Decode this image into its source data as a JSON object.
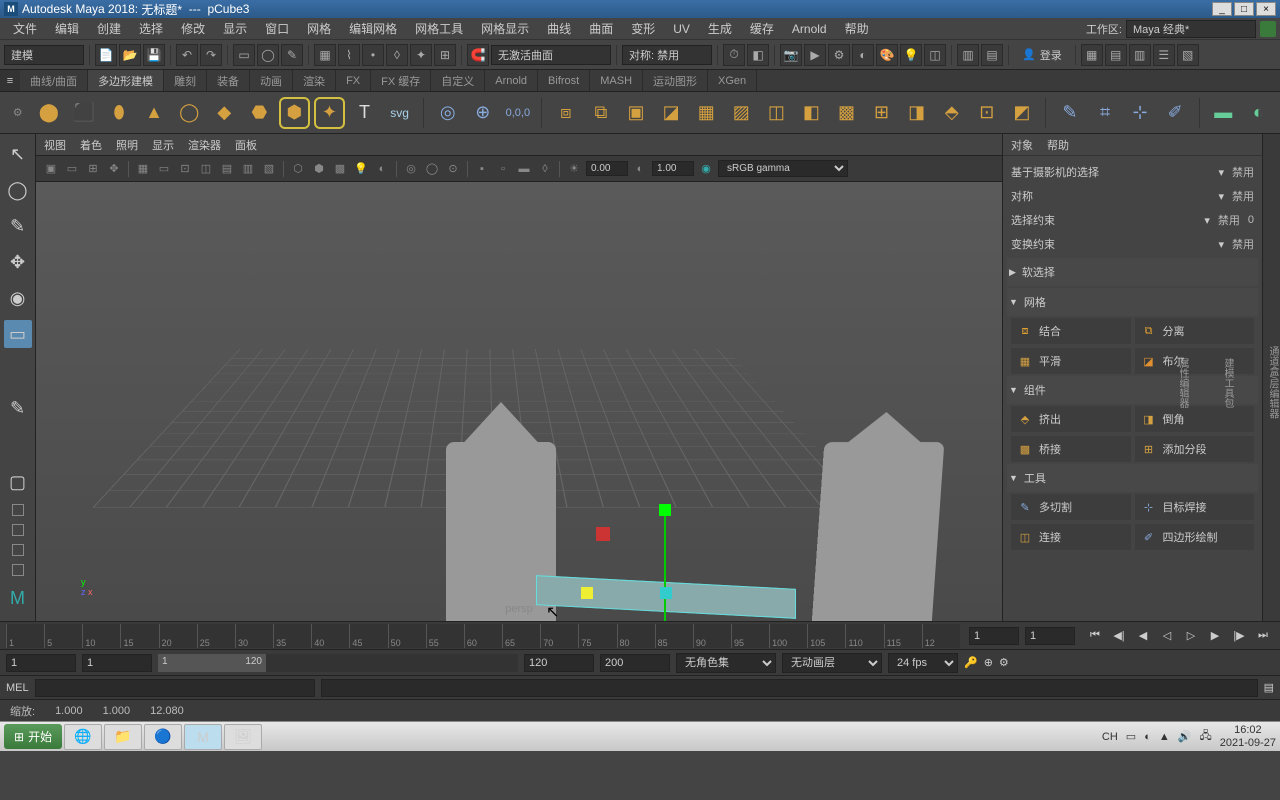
{
  "title": {
    "app": "Autodesk Maya 2018:",
    "doc": "无标题*",
    "sep": "---",
    "obj": "pCube3",
    "logo": "M"
  },
  "win": {
    "min": "_",
    "max": "□",
    "close": "×"
  },
  "menu": {
    "items": [
      "文件",
      "编辑",
      "创建",
      "选择",
      "修改",
      "显示",
      "窗口",
      "网格",
      "编辑网格",
      "网格工具",
      "网格显示",
      "曲线",
      "曲面",
      "变形",
      "UV",
      "生成",
      "缓存",
      "Arnold",
      "帮助"
    ],
    "workspace_label": "工作区:",
    "workspace_value": "Maya 经典*"
  },
  "toolbar": {
    "mode": "建模",
    "curve_mode": "无激活曲面",
    "sym": "对称: 禁用",
    "login": "登录"
  },
  "shelf": {
    "tabs": [
      "曲线/曲面",
      "多边形建模",
      "雕刻",
      "装备",
      "动画",
      "渲染",
      "FX",
      "FX 缓存",
      "自定义",
      "Arnold",
      "Bifrost",
      "MASH",
      "运动图形",
      "XGen"
    ],
    "active": 1,
    "svg": "svg",
    "text": "T"
  },
  "viewMenu": {
    "items": [
      "视图",
      "着色",
      "照明",
      "显示",
      "渲染器",
      "面板"
    ]
  },
  "viewToolbar": {
    "exposure": "0.00",
    "gamma": "1.00",
    "colorspace": "sRGB gamma"
  },
  "viewport": {
    "camera": "persp",
    "axes": {
      "x": "x",
      "y": "y",
      "z": "z"
    }
  },
  "rightPanel": {
    "tabs": [
      "对象",
      "帮助"
    ],
    "cam_sel_label": "基于摄影机的选择",
    "cam_sel_val": "禁用",
    "sym_label": "对称",
    "sym_val": "禁用",
    "selcon_label": "选择约束",
    "selcon_val": "禁用",
    "selcon_num": "0",
    "xformcon_label": "变换约束",
    "xformcon_val": "禁用",
    "softsel": "软选择",
    "sec_mesh": "网格",
    "btn_combine": "结合",
    "btn_separate": "分离",
    "btn_smooth": "平滑",
    "btn_bool": "布尔",
    "sec_comp": "组件",
    "btn_extrude": "挤出",
    "btn_bevel": "倒角",
    "btn_bridge": "桥接",
    "btn_subdiv": "添加分段",
    "sec_tools": "工具",
    "btn_multicut": "多切割",
    "btn_targetweld": "目标焊接",
    "btn_connect": "连接",
    "btn_quaddraw": "四边形绘制"
  },
  "sideTabs": [
    "通道盒/层编辑器",
    "建模工具包",
    "属性编辑器"
  ],
  "timeline": {
    "ticks": [
      "1",
      "5",
      "10",
      "15",
      "20",
      "25",
      "30",
      "35",
      "40",
      "45",
      "50",
      "55",
      "60",
      "65",
      "70",
      "75",
      "80",
      "85",
      "90",
      "95",
      "100",
      "105",
      "110",
      "115",
      "12"
    ],
    "current": "1",
    "current2": "1"
  },
  "range": {
    "start": "1",
    "in": "1",
    "inshow": "1",
    "out": "120",
    "outshow": "120",
    "end": "200",
    "charset": "无角色集",
    "animlayer": "无动画层",
    "fps": "24 fps"
  },
  "cmd": {
    "lang": "MEL"
  },
  "help": {
    "zoom": "缩放:",
    "v1": "1.000",
    "v2": "1.000",
    "v3": "12.080"
  },
  "taskbar": {
    "start": "开始",
    "lang": "CH",
    "time": "16:02",
    "date": "2021-09-27"
  }
}
